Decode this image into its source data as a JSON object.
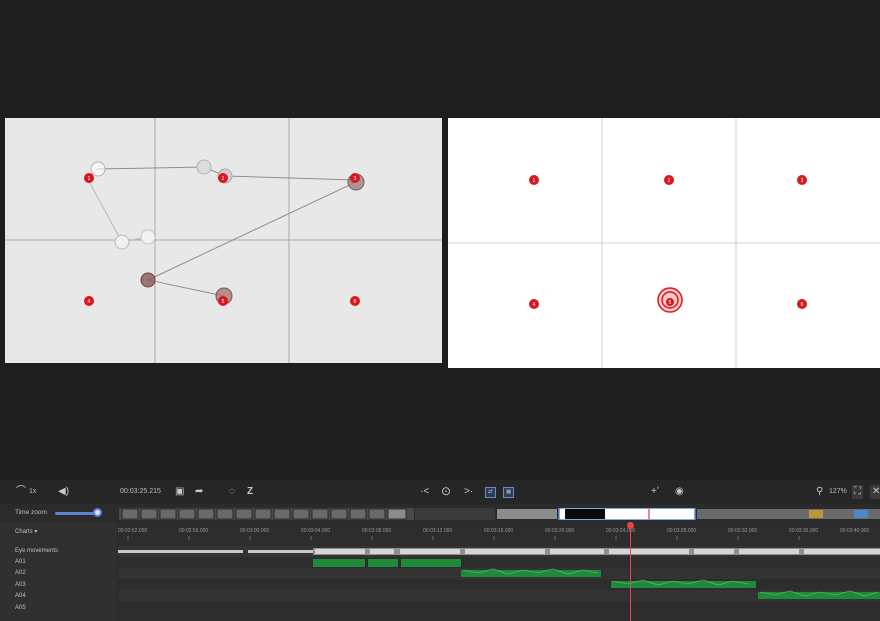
{
  "playback": {
    "speed": "1x",
    "timecode": "00:03:25.215",
    "zoom_level": "127%"
  },
  "icons": {
    "speed": "speed-icon",
    "volume": "volume-icon",
    "snapshot": "snapshot-icon",
    "share": "share-icon",
    "marker": "marker-icon",
    "z_tool": "z-icon",
    "prev": "previous-icon",
    "play": "play-icon",
    "next": "next-icon",
    "add": "add-event-icon",
    "settings": "settings-icon",
    "search": "search-icon",
    "fit": "fit-icon",
    "close": "close-icon"
  },
  "toggles": {
    "events_label": "⇄",
    "metrics_label": "▦"
  },
  "time_zoom": {
    "label": "Time zoom",
    "value": 1.0
  },
  "charts_menu": {
    "label": "Charts"
  },
  "rows": [
    {
      "label": "Eye movements"
    },
    {
      "label": "A01"
    },
    {
      "label": "A02"
    },
    {
      "label": "A03"
    },
    {
      "label": "A04"
    },
    {
      "label": "A05"
    }
  ],
  "time_ticks": [
    "00:02:52.000",
    "00:02:56.000",
    "00:03:00.000",
    "00:03:04.000",
    "00:03:08.000",
    "00:03:12.000",
    "00:03:16.000",
    "00:03:20.000",
    "00:03:24.000",
    "00:03:28.000",
    "00:03:32.000",
    "00:03:36.000",
    "00:03:40.000"
  ],
  "stimulus_markers": [
    "1",
    "2",
    "3",
    "4",
    "5",
    "6"
  ],
  "colors": {
    "marker_red": "#d9171e",
    "aoi_green": "#1f8a3a",
    "playhead": "#e74545",
    "selection_blue": "#5f84d6"
  }
}
